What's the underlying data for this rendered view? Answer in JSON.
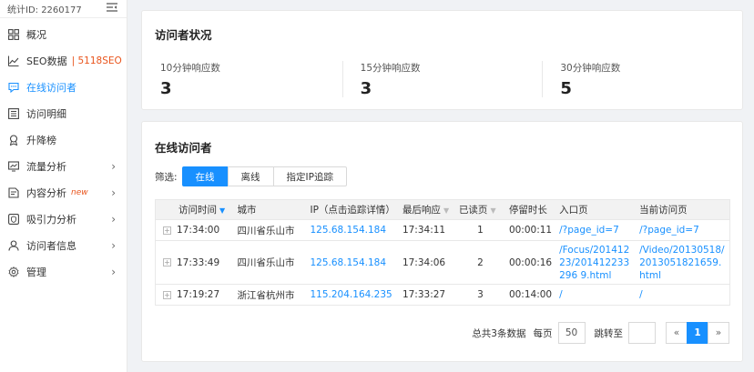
{
  "sidebar": {
    "stat_id": "统计ID: 2260177",
    "items": [
      {
        "label": "概况",
        "icon": "grid-icon"
      },
      {
        "label": "SEO数据",
        "extra": "| 5118SEO",
        "icon": "trend-icon"
      },
      {
        "label": "在线访问者",
        "icon": "chat-icon"
      },
      {
        "label": "访问明细",
        "icon": "list-icon"
      },
      {
        "label": "升降榜",
        "icon": "badge-icon"
      },
      {
        "label": "流量分析",
        "icon": "flow-icon"
      },
      {
        "label": "内容分析",
        "tag": "new",
        "icon": "content-icon"
      },
      {
        "label": "吸引力分析",
        "icon": "shield-icon"
      },
      {
        "label": "访问者信息",
        "icon": "user-icon"
      },
      {
        "label": "管理",
        "icon": "gear-icon"
      }
    ]
  },
  "status": {
    "title": "访问者状况",
    "stats": [
      {
        "label": "10分钟响应数",
        "value": "3"
      },
      {
        "label": "15分钟响应数",
        "value": "3"
      },
      {
        "label": "30分钟响应数",
        "value": "5"
      }
    ]
  },
  "online": {
    "title": "在线访问者",
    "filter_label": "筛选:",
    "filters": [
      "在线",
      "离线",
      "指定IP追踪"
    ],
    "columns": [
      "访问时间",
      "城市",
      "IP（点击追踪详情）",
      "最后响应",
      "已读页",
      "停留时长",
      "入口页",
      "当前访问页"
    ],
    "rows": [
      {
        "time": "17:34:00",
        "city": "四川省乐山市",
        "ip": "125.68.154.184",
        "last": "17:34:11",
        "pages": "1",
        "stay": "00:00:11",
        "entry": "/?page_id=7",
        "current": "/?page_id=7"
      },
      {
        "time": "17:33:49",
        "city": "四川省乐山市",
        "ip": "125.68.154.184",
        "last": "17:34:06",
        "pages": "2",
        "stay": "00:00:16",
        "entry": "/Focus/20141223/201412233296 9.html",
        "current": "/Video/20130518/ 2013051821659. html"
      },
      {
        "time": "17:19:27",
        "city": "浙江省杭州市",
        "ip": "115.204.164.235",
        "last": "17:33:27",
        "pages": "3",
        "stay": "00:14:00",
        "entry": "/",
        "current": "/"
      }
    ]
  },
  "pager": {
    "summary": "总共3条数据",
    "per_page_label": "每页",
    "per_page": "50",
    "jump_label": "跳转至",
    "prev": "«",
    "current": "1",
    "next": "»"
  }
}
